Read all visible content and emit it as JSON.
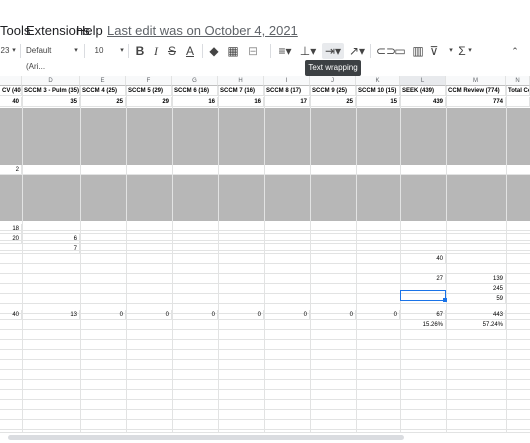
{
  "menu": {
    "items": [
      "Tools",
      "Extensions",
      "Help"
    ],
    "last_edit": "Last edit was on October 4, 2021"
  },
  "toolbar": {
    "zoom_fragment": "23",
    "font": "Default (Ari...",
    "font_size": "10",
    "text_color": "A",
    "tooltip": "Text wrapping"
  },
  "columns": [
    "",
    "D",
    "E",
    "F",
    "G",
    "H",
    "I",
    "J",
    "K",
    "L",
    "M",
    "N"
  ],
  "headers": [
    "CV (40)",
    "SCCM 3 - Pulm (35)",
    "SCCM 4 (25)",
    "SCCM 5 (29)",
    "SCCM 6 (16)",
    "SCCM 7 (16)",
    "SCCM 8 (17)",
    "SCCM 9 (25)",
    "SCCM 10 (15)",
    "SEEK  (439)",
    "CCM Review (774)",
    "Total Co"
  ],
  "totals": [
    "40",
    "35",
    "25",
    "29",
    "16",
    "16",
    "17",
    "25",
    "15",
    "439",
    "774",
    ""
  ],
  "values": {
    "r_cv2": "2",
    "r18": "18",
    "r20": "20",
    "r20d": "6",
    "r7": "7",
    "l40": "40",
    "l27": "27",
    "m139": "139",
    "m245": "245",
    "m59": "59",
    "sum": [
      "40",
      "13",
      "0",
      "0",
      "0",
      "0",
      "0",
      "0",
      "0",
      "67",
      "443",
      ""
    ],
    "pct_l": "15.26%",
    "pct_m": "57.24%"
  },
  "colors": {
    "accent": "#1a73e8",
    "gray_block": "#b7b7b7"
  }
}
